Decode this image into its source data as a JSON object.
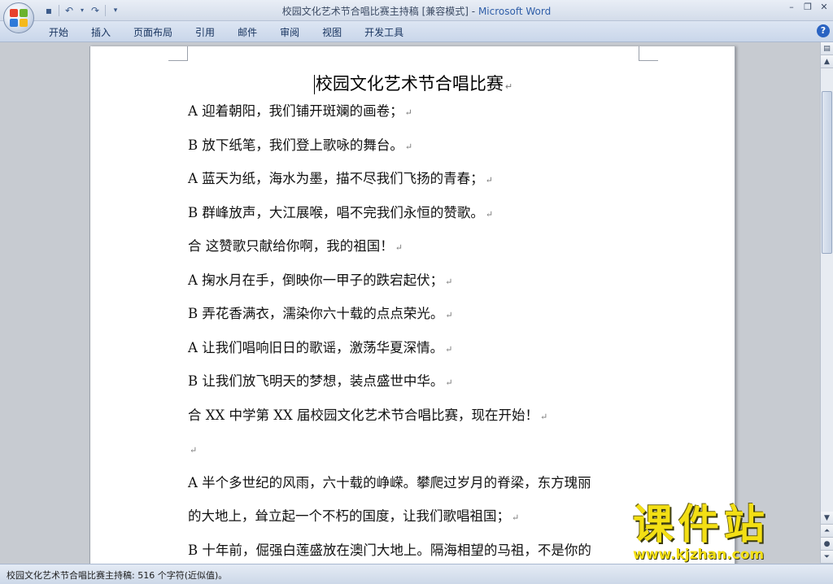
{
  "window": {
    "doc_title": "校园文化艺术节合唱比赛主持稿 [兼容模式]",
    "app_name": "Microsoft Word",
    "separator": " - "
  },
  "quick_access": {
    "icons": [
      "save-icon",
      "undo-icon",
      "redo-icon",
      "customize-icon"
    ]
  },
  "ribbon": {
    "tabs": [
      "开始",
      "插入",
      "页面布局",
      "引用",
      "邮件",
      "审阅",
      "视图",
      "开发工具"
    ]
  },
  "document": {
    "title": "校园文化艺术节合唱比赛",
    "paragraph_mark": "↵",
    "lines": [
      "A 迎着朝阳，我们铺开斑斓的画卷；",
      "B 放下纸笔，我们登上歌咏的舞台。",
      "A 蓝天为纸，海水为墨，描不尽我们飞扬的青春；",
      "B 群峰放声，大江展喉，唱不完我们永恒的赞歌。",
      "合 这赞歌只献给你啊，我的祖国！",
      "A 掬水月在手，倒映你一甲子的跌宕起伏；",
      "B 弄花香满衣，濡染你六十载的点点荣光。",
      "A 让我们唱响旧日的歌谣，激荡华夏深情。",
      "B 让我们放飞明天的梦想，装点盛世中华。",
      "合 XX 中学第 XX 届校园文化艺术节合唱比赛，现在开始！",
      "",
      "A 半个多世纪的风雨，六十载的峥嵘。攀爬过岁月的脊梁，东方瑰丽",
      "的大地上，耸立起一个不朽的国度，让我们歌唱祖国；",
      "B 十年前，倔强白莲盛放在澳门大地上。隔海相望的马祖，不是你的"
    ],
    "line_has_mark": [
      true,
      true,
      true,
      true,
      true,
      true,
      true,
      true,
      true,
      true,
      true,
      false,
      true,
      false
    ]
  },
  "status": {
    "text": "校园文化艺术节合唱比赛主持稿: 516 个字符(近似值)。"
  },
  "watermark": {
    "brand": "课件站",
    "url": "www.kjzhan.com"
  },
  "colors": {
    "watermark": "#f3df14",
    "app_name": "#2f5ea8"
  }
}
